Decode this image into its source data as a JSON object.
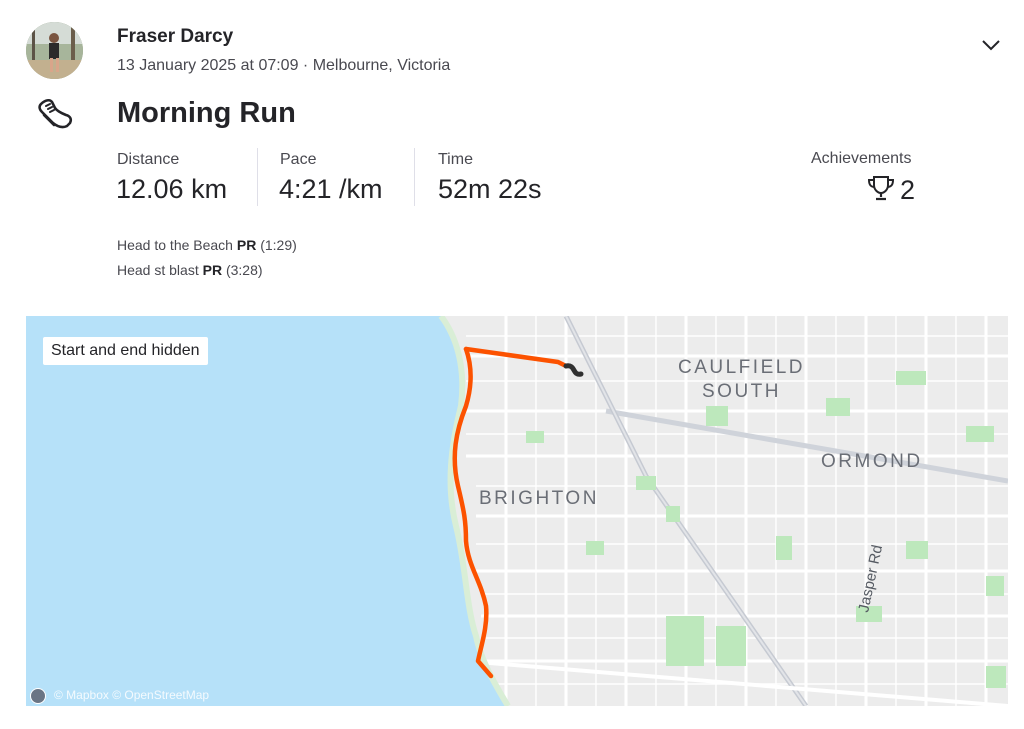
{
  "header": {
    "athlete_name": "Fraser Darcy",
    "meta": "13 January 2025 at 07:09 · Melbourne, Victoria"
  },
  "activity": {
    "sport_icon": "running-shoe-icon",
    "title": "Morning Run",
    "stats": [
      {
        "label": "Distance",
        "value": "12.06 km"
      },
      {
        "label": "Pace",
        "value": "4:21 /km"
      },
      {
        "label": "Time",
        "value": "52m 22s"
      }
    ],
    "achievements": {
      "label": "Achievements",
      "count": "2",
      "icon": "trophy-icon"
    },
    "segments": [
      {
        "name": "Head to the Beach",
        "badge": "PR",
        "time": "(1:29)"
      },
      {
        "name": "Head st blast",
        "badge": "PR",
        "time": "(3:28)"
      }
    ]
  },
  "map": {
    "badge": "Start and end hidden",
    "places": [
      "CAULFIELD",
      "SOUTH",
      "ORMOND",
      "BRIGHTON",
      "Jasper Rd"
    ],
    "attribution": "© Mapbox © OpenStreetMap",
    "colors": {
      "water": "#b6e1f9",
      "land": "#ececec",
      "park": "#bde8bc",
      "route": "#fc5200"
    }
  }
}
